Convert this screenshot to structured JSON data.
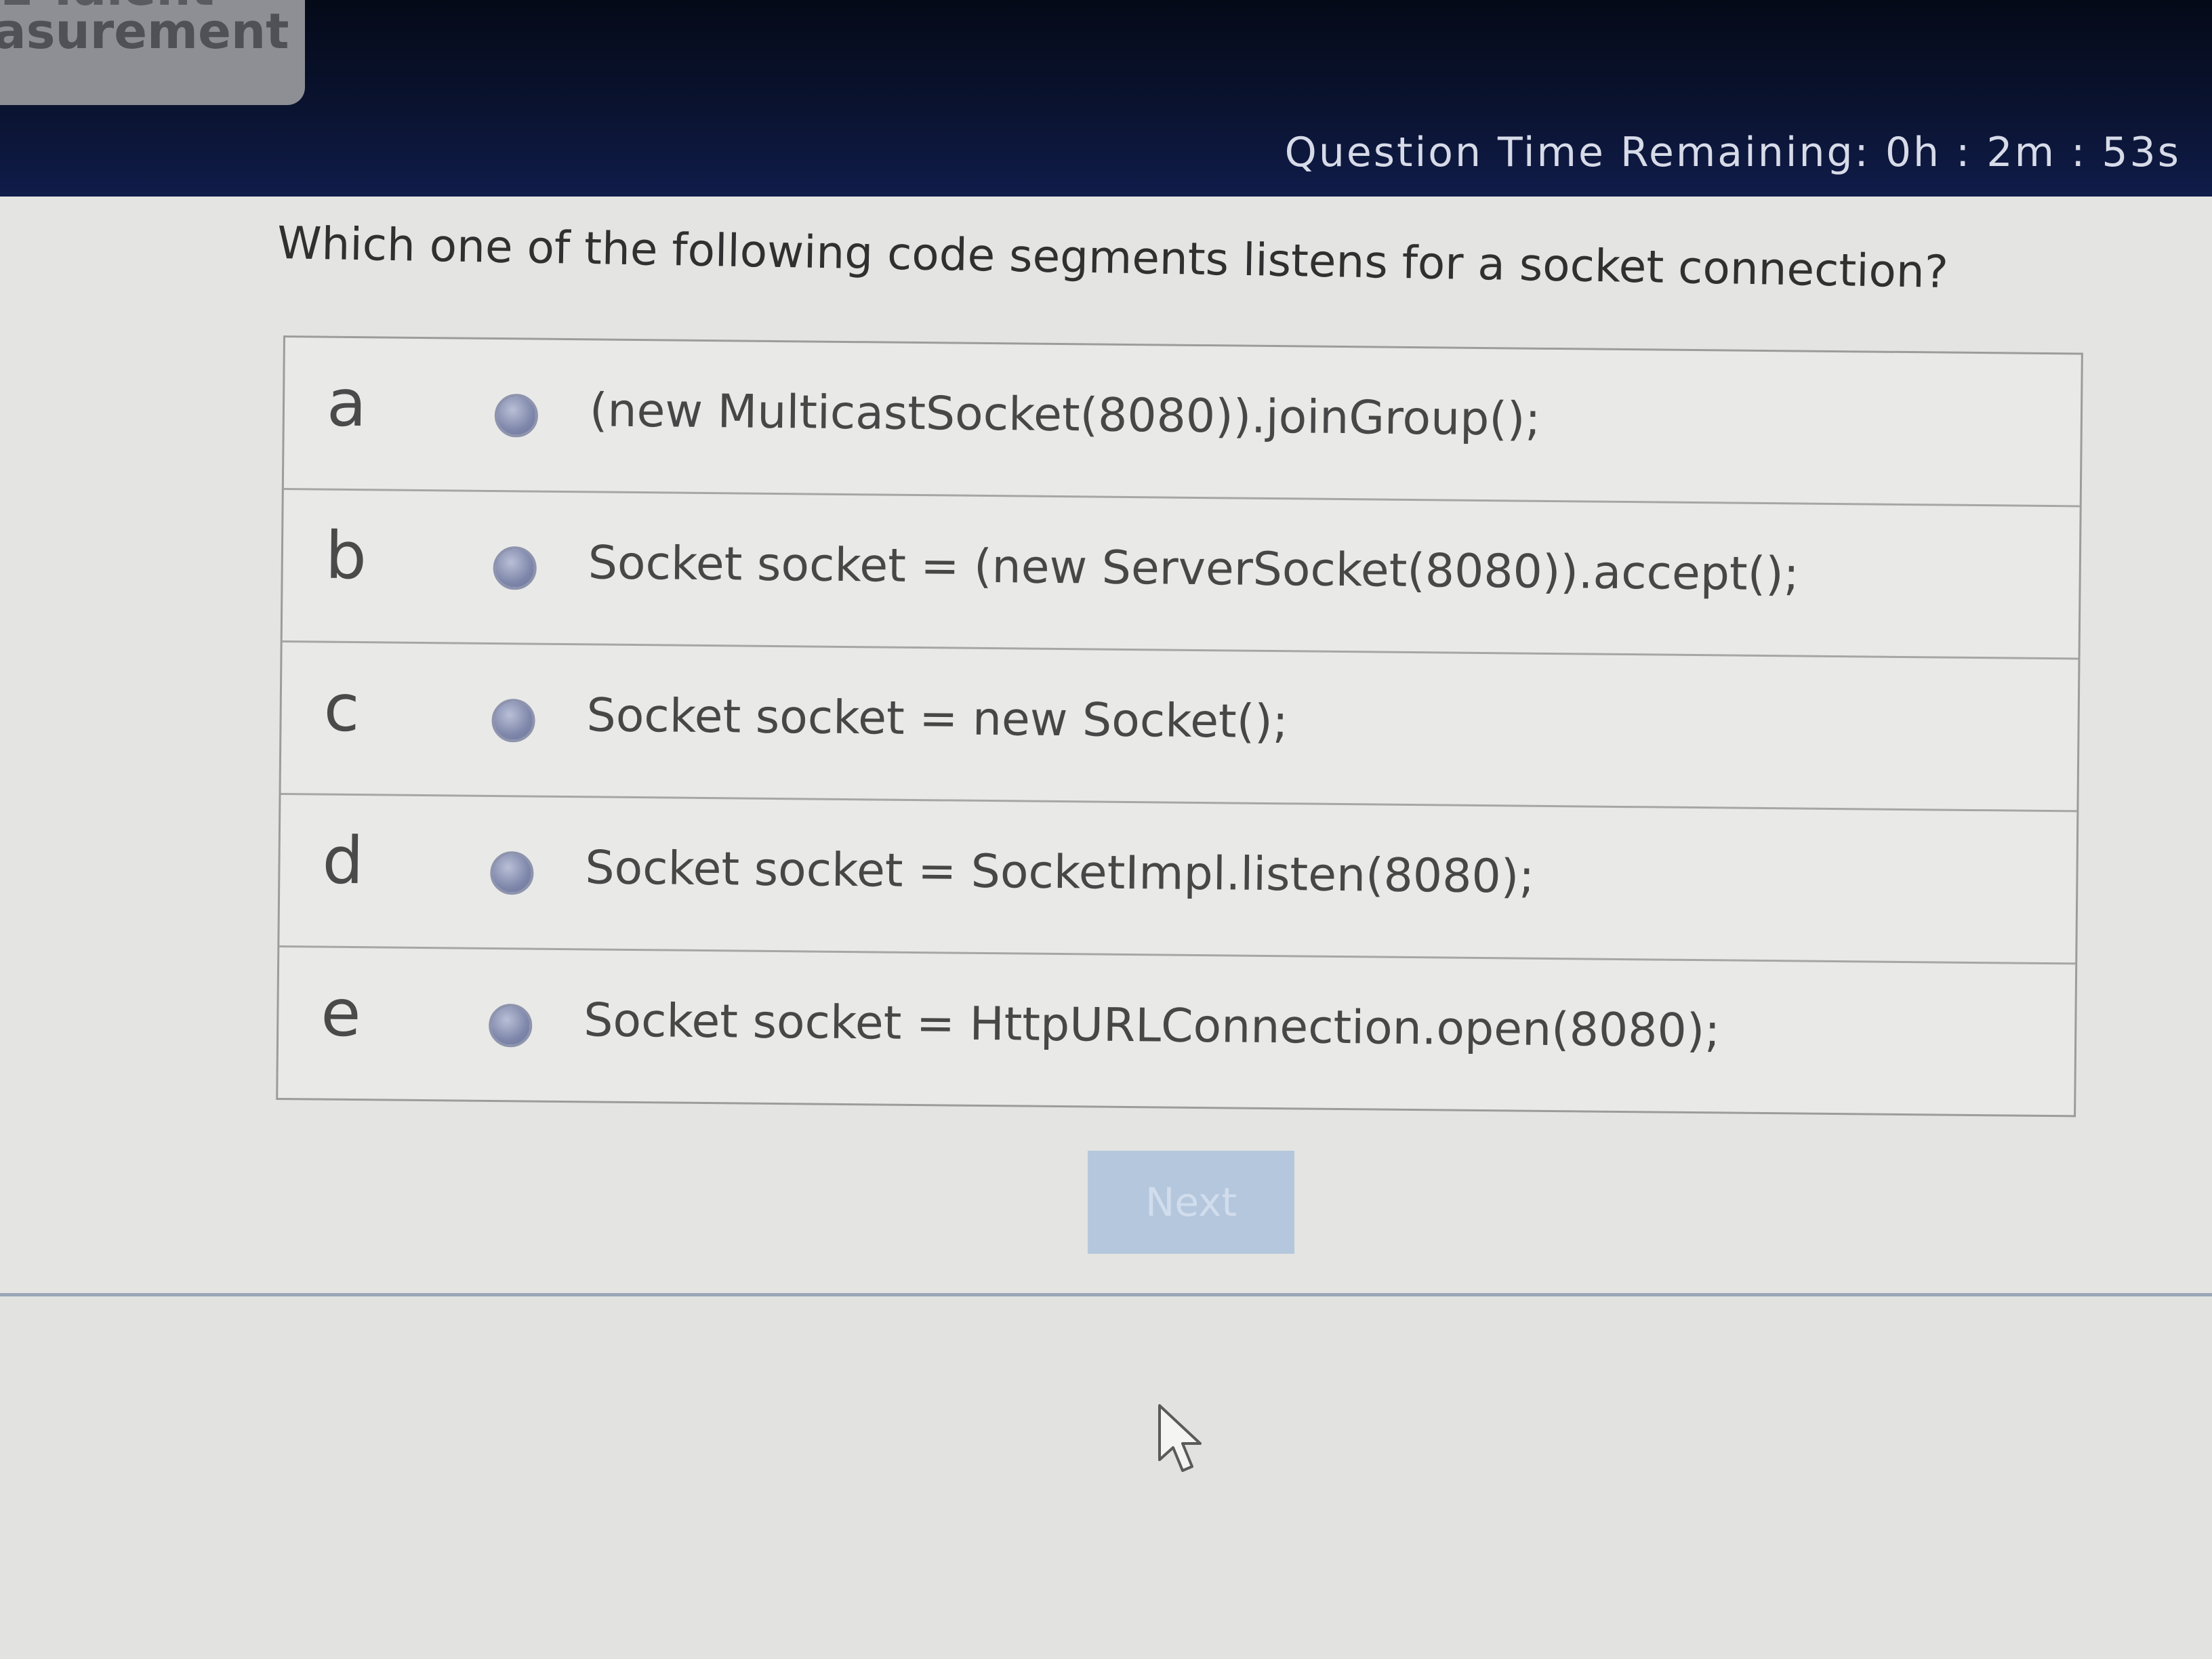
{
  "header": {
    "logo_line1": "E-Talent",
    "logo_line2": "asurement",
    "timer": "Question Time Remaining: 0h : 2m : 53s"
  },
  "question": {
    "text": "Which one of the following code segments listens for a socket connection?",
    "options": [
      {
        "letter": "a",
        "code": "(new MulticastSocket(8080)).joinGroup();"
      },
      {
        "letter": "b",
        "code": "Socket socket = (new ServerSocket(8080)).accept();"
      },
      {
        "letter": "c",
        "code": "Socket socket = new Socket();"
      },
      {
        "letter": "d",
        "code": "Socket socket = SocketImpl.listen(8080);"
      },
      {
        "letter": "e",
        "code": "Socket socket = HttpURLConnection.open(8080);"
      }
    ]
  },
  "actions": {
    "next_label": "Next"
  },
  "colors": {
    "header_bg": "#0a1330",
    "page_bg": "#e4e4e2",
    "radio": "#7f88ab",
    "next_button": "#b4c7dc"
  },
  "icons": {
    "cursor": "mouse-pointer-icon"
  }
}
